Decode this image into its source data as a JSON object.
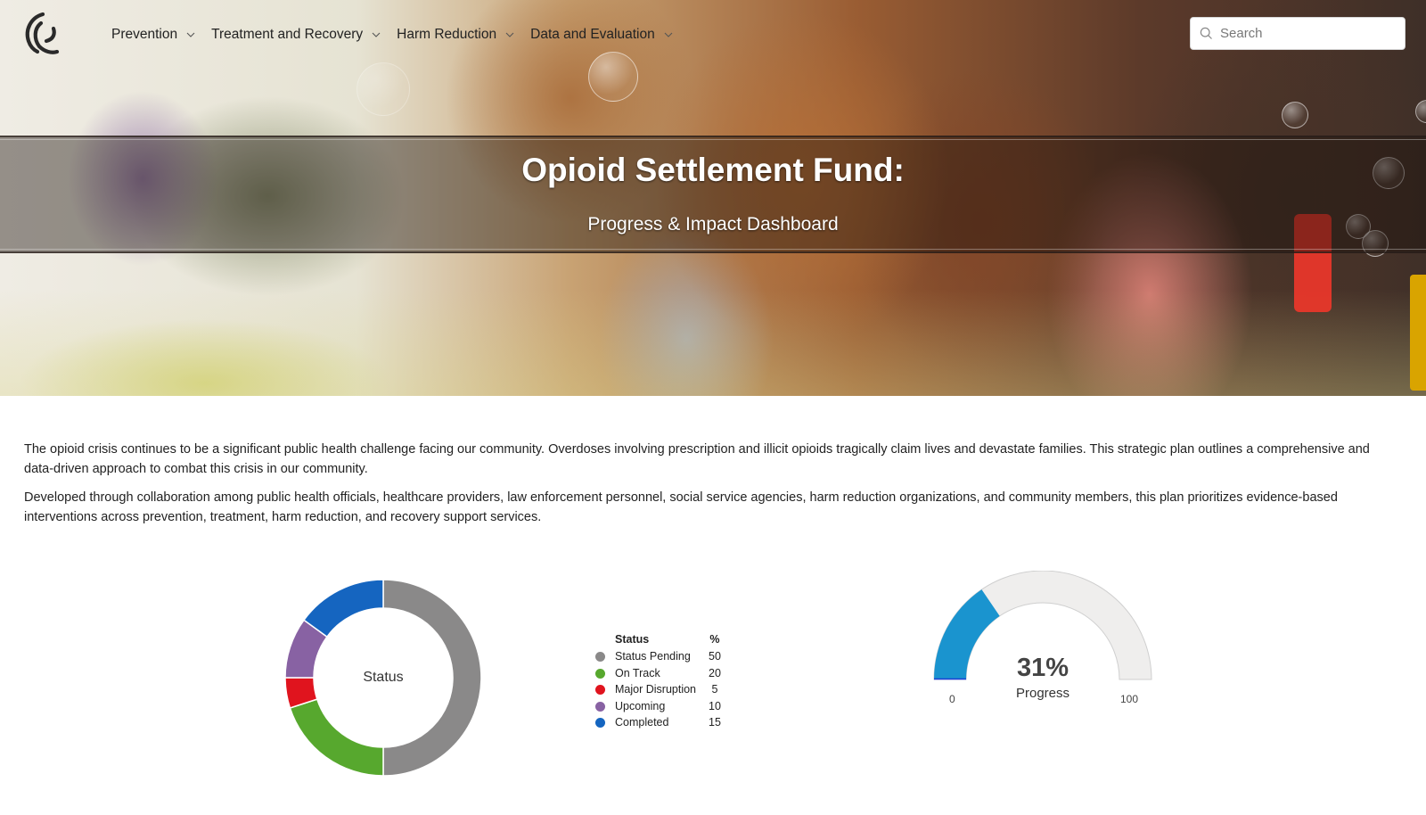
{
  "nav": {
    "logo": "site-logo",
    "items": [
      {
        "label": "Prevention",
        "icon": "chevron-down-icon"
      },
      {
        "label": "Treatment and Recovery",
        "icon": "chevron-down-icon"
      },
      {
        "label": "Harm Reduction",
        "icon": "chevron-down-icon"
      },
      {
        "label": "Data and Evaluation",
        "icon": "chevron-down-icon"
      }
    ],
    "search": {
      "placeholder": "Search",
      "value": "",
      "icon": "search-icon"
    }
  },
  "hero": {
    "title": "Opioid Settlement Fund:",
    "subtitle": "Progress & Impact Dashboard"
  },
  "intro": {
    "paragraphs": [
      "The opioid crisis continues to be a significant public health challenge facing our community. Overdoses involving prescription and illicit opioids tragically claim lives and devastate families.  This strategic plan outlines a comprehensive and data-driven approach to combat this crisis in our community.",
      "Developed through collaboration among public health officials, healthcare providers, law enforcement personnel, social service agencies, harm reduction organizations, and community members, this plan prioritizes evidence-based interventions across prevention, treatment, harm reduction, and recovery support services."
    ]
  },
  "chart_data": [
    {
      "type": "pie",
      "subtype": "donut",
      "title": "Status",
      "center_label": "Status",
      "legend_header": {
        "label": "Status",
        "value": "%"
      },
      "legend_position": "right",
      "categories": [
        "Status Pending",
        "On Track",
        "Major Disruption",
        "Upcoming",
        "Completed"
      ],
      "values": [
        50,
        20,
        5,
        10,
        15
      ],
      "colors": [
        "#8a8989",
        "#57a82e",
        "#e0141e",
        "#8862a3",
        "#1565c0"
      ]
    },
    {
      "type": "gauge",
      "title": "Progress",
      "value": 31,
      "value_label": "31%",
      "label": "Progress",
      "min": 0,
      "max": 100,
      "min_label": "0",
      "max_label": "100",
      "fill_color": "#1a94cf",
      "track_color": "#efeeed"
    }
  ]
}
